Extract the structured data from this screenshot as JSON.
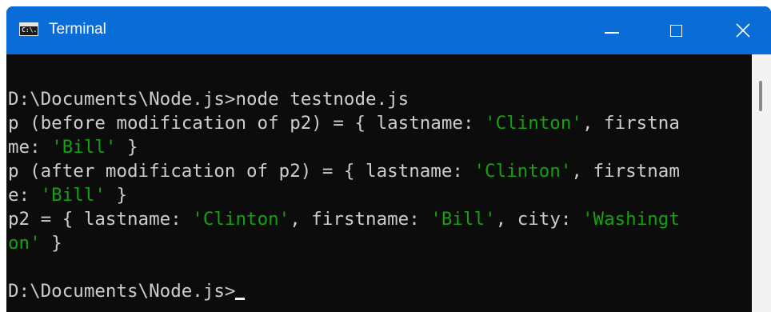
{
  "window": {
    "title": "Terminal",
    "app_icon_text": "C:\\."
  },
  "controls": {
    "minimize": "minimize",
    "maximize": "maximize",
    "close": "close"
  },
  "console": {
    "lines": [
      {
        "segments": [
          {
            "text": "",
            "color": "default"
          }
        ]
      },
      {
        "segments": [
          {
            "text": "D:\\Documents\\Node.js>node testnode.js",
            "color": "default"
          }
        ]
      },
      {
        "segments": [
          {
            "text": "p (before modification of p2) = { lastname: ",
            "color": "default"
          },
          {
            "text": "'Clinton'",
            "color": "green"
          },
          {
            "text": ", firstna",
            "color": "default"
          }
        ]
      },
      {
        "segments": [
          {
            "text": "me: ",
            "color": "default"
          },
          {
            "text": "'Bill'",
            "color": "green"
          },
          {
            "text": " }",
            "color": "default"
          }
        ]
      },
      {
        "segments": [
          {
            "text": "p (after modification of p2) = { lastname: ",
            "color": "default"
          },
          {
            "text": "'Clinton'",
            "color": "green"
          },
          {
            "text": ", firstnam",
            "color": "default"
          }
        ]
      },
      {
        "segments": [
          {
            "text": "e: ",
            "color": "default"
          },
          {
            "text": "'Bill'",
            "color": "green"
          },
          {
            "text": " }",
            "color": "default"
          }
        ]
      },
      {
        "segments": [
          {
            "text": "p2 = { lastname: ",
            "color": "default"
          },
          {
            "text": "'Clinton'",
            "color": "green"
          },
          {
            "text": ", firstname: ",
            "color": "default"
          },
          {
            "text": "'Bill'",
            "color": "green"
          },
          {
            "text": ", city: ",
            "color": "default"
          },
          {
            "text": "'Washingt",
            "color": "green"
          }
        ]
      },
      {
        "segments": [
          {
            "text": "on'",
            "color": "green"
          },
          {
            "text": " }",
            "color": "default"
          }
        ]
      },
      {
        "segments": [
          {
            "text": "",
            "color": "default"
          }
        ]
      },
      {
        "segments": [
          {
            "text": "D:\\Documents\\Node.js>",
            "color": "default"
          }
        ],
        "cursor": true
      }
    ]
  },
  "colors": {
    "titlebar": "#0a6cd6",
    "background": "#0c0c0c",
    "text": "#cccccc",
    "string": "#13a10e"
  },
  "icons": {
    "app": "console-icon",
    "minimize": "minimize-icon",
    "maximize": "maximize-icon",
    "close": "close-icon"
  }
}
